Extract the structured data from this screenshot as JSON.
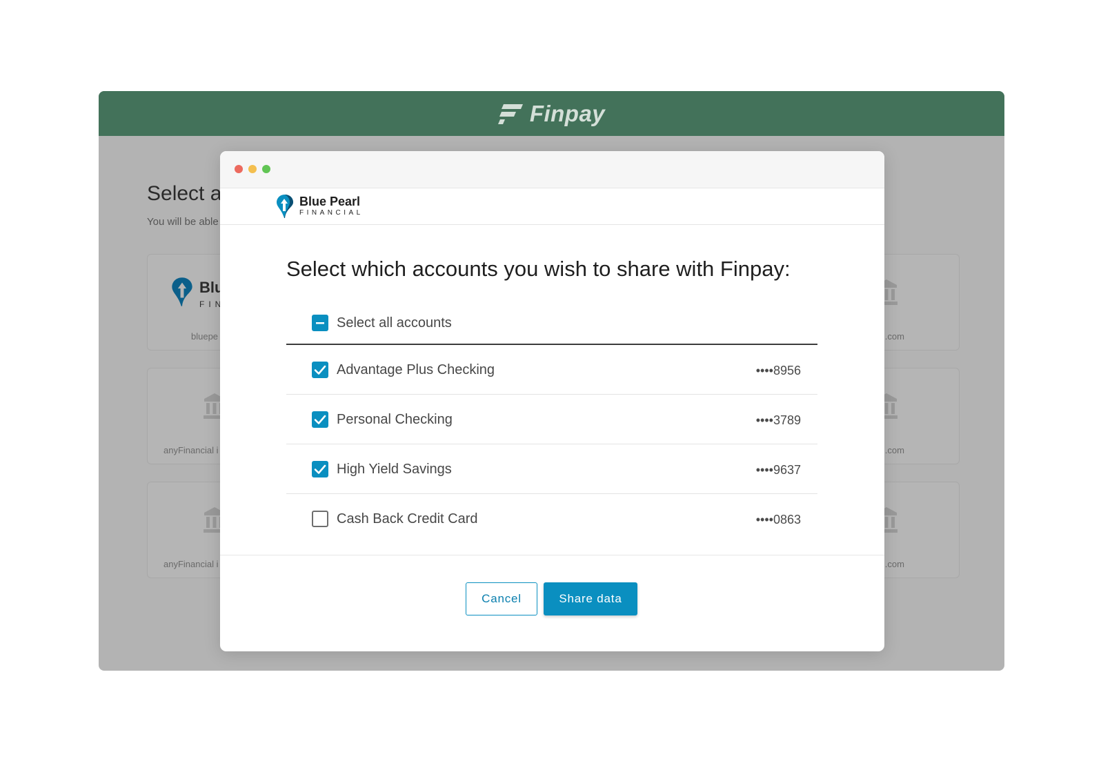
{
  "app": {
    "brand_name": "Finpay",
    "colors": {
      "header": "#43725a",
      "accent": "#0a8fc0",
      "backdrop": "#b3b3b3"
    }
  },
  "background_page": {
    "title": "Select a",
    "subtitle": "You will be able",
    "cards": [
      {
        "label": "bluepe",
        "icon": "blue-pearl-logo",
        "brand_text": "Blu",
        "brand_sub": "FIN"
      },
      {
        "label": "anyFinancial i",
        "icon": "bank-icon"
      },
      {
        "label": "anyFinancial i",
        "icon": "bank-icon"
      },
      {
        "label": "stitution.com",
        "icon": "bank-icon"
      },
      {
        "label": "stitution.com",
        "icon": "bank-icon"
      },
      {
        "label": "stitution.com",
        "icon": "bank-icon"
      }
    ]
  },
  "modal": {
    "bank_name": "Blue Pearl",
    "bank_sub": "FINANCIAL",
    "heading": "Select which accounts you wish to share with Finpay:",
    "select_all": {
      "label": "Select all accounts",
      "state": "indeterminate"
    },
    "accounts": [
      {
        "name": "Advantage Plus Checking",
        "mask": "••••8956",
        "checked": true
      },
      {
        "name": "Personal Checking",
        "mask": "••••3789",
        "checked": true
      },
      {
        "name": "High Yield Savings",
        "mask": "••••9637",
        "checked": true
      },
      {
        "name": "Cash Back Credit Card",
        "mask": "••••0863",
        "checked": false
      }
    ],
    "buttons": {
      "cancel": "Cancel",
      "share": "Share data"
    }
  }
}
